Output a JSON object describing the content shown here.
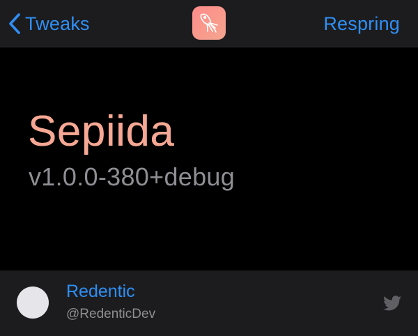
{
  "navbar": {
    "back_label": "Tweaks",
    "right_button_label": "Respring",
    "app_icon": "squid-icon",
    "accent_color": "#2f8ff5"
  },
  "header": {
    "title": "Sepiida",
    "version": "v1.0.0-380+debug",
    "title_color": "#f6a894",
    "version_color": "#8e8e93"
  },
  "author": {
    "name": "Redentic",
    "handle": "@RedenticDev",
    "social_icon": "twitter-icon"
  }
}
